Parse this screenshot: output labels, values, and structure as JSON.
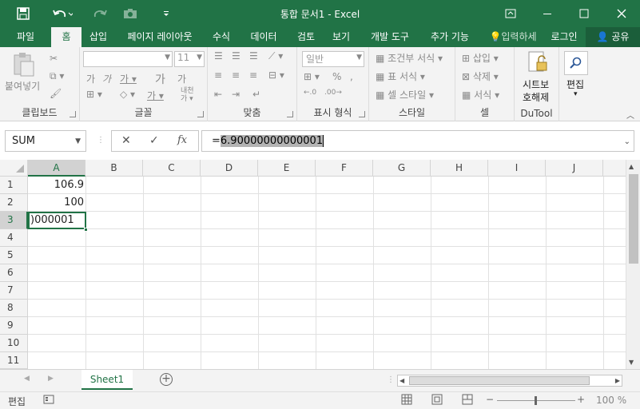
{
  "window": {
    "title": "통합 문서1 - Excel"
  },
  "tabs": [
    {
      "label": "파일"
    },
    {
      "label": "홈"
    },
    {
      "label": "삽입"
    },
    {
      "label": "페이지 레이아웃"
    },
    {
      "label": "수식"
    },
    {
      "label": "데이터"
    },
    {
      "label": "검토"
    },
    {
      "label": "보기"
    },
    {
      "label": "개발 도구"
    },
    {
      "label": "추가 기능"
    }
  ],
  "tell_me": "입력하세",
  "login": "로그인",
  "share": "공유",
  "ribbon": {
    "clipboard": {
      "label": "클립보드",
      "paste": "붙여넣기"
    },
    "font": {
      "label": "글꼴",
      "size": "11"
    },
    "alignment": {
      "label": "맞춤"
    },
    "number": {
      "label": "표시 형식",
      "format": "일반"
    },
    "styles": {
      "label": "스타일",
      "conditional": "조건부 서식",
      "table": "표 서식",
      "cell": "셀 스타일"
    },
    "cells": {
      "label": "셀",
      "insert": "삽입",
      "delete": "삭제",
      "format": "서식"
    },
    "dutool": {
      "label": "DuTool",
      "refresh_line1": "시트보",
      "refresh_line2": "호해제"
    },
    "editing": {
      "label": "편집"
    }
  },
  "formula_bar": {
    "name_box": "SUM",
    "prefix": "=",
    "formula_selected": "6.90000000000001",
    "fx": "fx"
  },
  "columns": [
    "A",
    "B",
    "C",
    "D",
    "E",
    "F",
    "G",
    "H",
    "I",
    "J"
  ],
  "rows": [
    "1",
    "2",
    "3",
    "4",
    "5",
    "6",
    "7",
    "8",
    "9",
    "10",
    "11"
  ],
  "cells": {
    "A1": "106.9",
    "A2": "100",
    "A3": ")000001"
  },
  "sheet": {
    "tab": "Sheet1"
  },
  "status": {
    "mode": "편집",
    "zoom": "100 %"
  }
}
